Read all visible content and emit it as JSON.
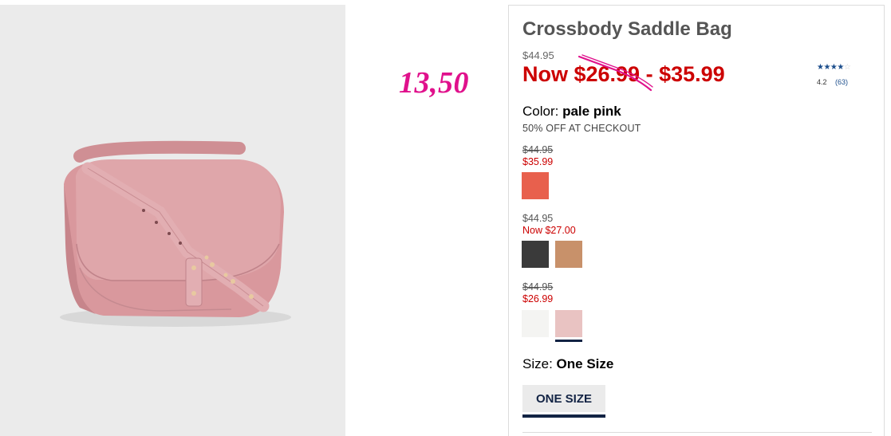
{
  "product": {
    "title": "Crossbody Saddle Bag",
    "original_price": "$44.95",
    "sale_price": "Now $26.99 - $35.99"
  },
  "annotation": {
    "handwritten_price": "13,50",
    "color": "#e0118c"
  },
  "rating": {
    "stars": "★★★★",
    "empty_star": "☆",
    "value": "4.2",
    "count": "(63)"
  },
  "color_selector": {
    "label": "Color: ",
    "selected": "pale pink",
    "promo": "50% OFF AT CHECKOUT"
  },
  "price_groups": [
    {
      "original": "$44.95",
      "sale": "$35.99",
      "swatches": [
        {
          "name": "coral",
          "color": "#e8604d"
        }
      ]
    },
    {
      "original": "$44.95",
      "sale": "Now $27.00",
      "swatches": [
        {
          "name": "black",
          "color": "#3a3a3a"
        },
        {
          "name": "tan",
          "color": "#c8916a"
        }
      ]
    },
    {
      "original": "$44.95",
      "sale": "$26.99",
      "swatches": [
        {
          "name": "white",
          "color": "#f4f4f2"
        },
        {
          "name": "pale pink",
          "color": "#e9c3c2"
        }
      ]
    }
  ],
  "size_selector": {
    "label": "Size: ",
    "selected": "One Size",
    "option": "ONE SIZE"
  },
  "colors": {
    "sale_red": "#cc0000",
    "navy": "#122344",
    "bag_pink": "#d99b9f"
  }
}
